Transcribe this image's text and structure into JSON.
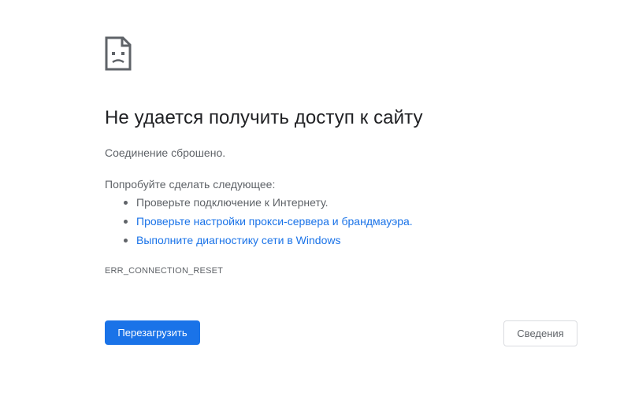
{
  "error": {
    "icon": "sad-page-icon",
    "title": "Не удается получить доступ к сайту",
    "subtitle": "Соединение сброшено.",
    "suggestions_heading": "Попробуйте сделать следующее:",
    "suggestions": [
      {
        "text": "Проверьте подключение к Интернету.",
        "link": false
      },
      {
        "text": "Проверьте настройки прокси-сервера и брандмауэра.",
        "link": true
      },
      {
        "text": "Выполните диагностику сети в Windows",
        "link": true
      }
    ],
    "code": "ERR_CONNECTION_RESET"
  },
  "buttons": {
    "reload_label": "Перезагрузить",
    "details_label": "Сведения"
  },
  "colors": {
    "accent": "#1a73e8",
    "text": "#202124",
    "muted": "#5f6368"
  }
}
